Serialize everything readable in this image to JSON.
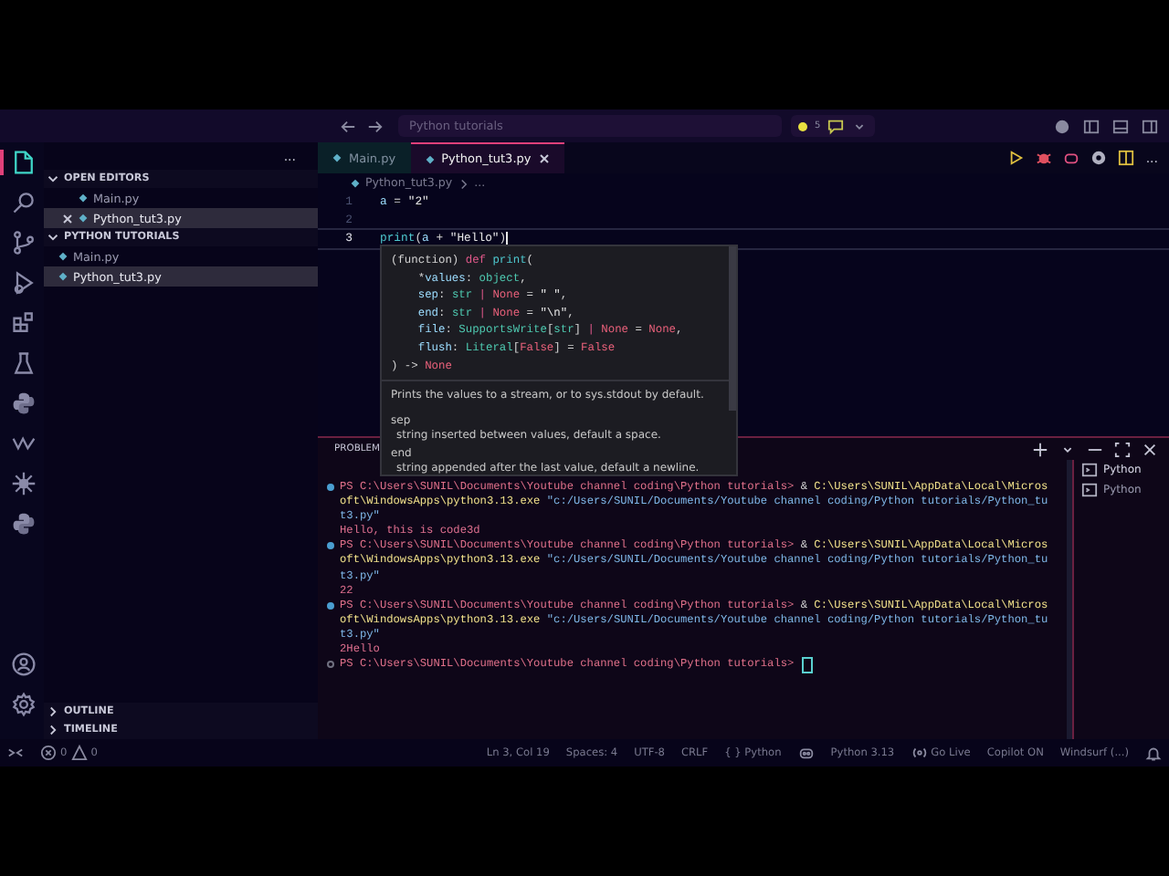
{
  "title_bar": {
    "search": "Python tutorials",
    "badge": "5"
  },
  "activity_bar": {
    "items": [
      {
        "kind": "explorer",
        "selected": true
      },
      {
        "kind": "search",
        "selected": false
      },
      {
        "kind": "source-control",
        "selected": false
      },
      {
        "kind": "debug",
        "selected": false
      },
      {
        "kind": "extensions",
        "selected": false
      },
      {
        "kind": "testing",
        "selected": false
      },
      {
        "kind": "python",
        "selected": false
      },
      {
        "kind": "zigzag",
        "selected": false
      },
      {
        "kind": "burst",
        "selected": false
      },
      {
        "kind": "python",
        "selected": false
      }
    ],
    "bottom": [
      {
        "kind": "account",
        "selected": false
      },
      {
        "kind": "settings",
        "selected": false
      }
    ]
  },
  "sidebar": {
    "more": "...",
    "sections": [
      {
        "title": "OPEN EDITORS",
        "expanded": true,
        "items": [
          {
            "label": "Main.py",
            "selected": false,
            "closable": false
          },
          {
            "label": "Python_tut3.py",
            "selected": true,
            "closable": true
          }
        ]
      },
      {
        "title": "PYTHON TUTORIALS",
        "expanded": true,
        "items": [
          {
            "label": "Main.py",
            "selected": false,
            "closable": false
          },
          {
            "label": "Python_tut3.py",
            "selected": true,
            "closable": false
          }
        ]
      }
    ],
    "bottom_sections": [
      {
        "title": "OUTLINE",
        "expanded": false
      },
      {
        "title": "TIMELINE",
        "expanded": false
      }
    ]
  },
  "tabs": [
    {
      "label": "Main.py",
      "selected": false
    },
    {
      "label": "Python_tut3.py",
      "selected": true
    }
  ],
  "editor_toolbar": {
    "more": "..."
  },
  "breadcrumb": [
    "Python_tut3.py",
    "..."
  ],
  "code": [
    {
      "number": "1",
      "current": false,
      "tokens": [
        {
          "kind": "var",
          "text": "a"
        },
        {
          "kind": "plain",
          "text": " = "
        },
        {
          "kind": "string",
          "text": "\"2\""
        }
      ]
    },
    {
      "number": "2",
      "current": false
    },
    {
      "number": "3",
      "current": true,
      "tokens": [
        {
          "kind": "fn",
          "text": "print"
        },
        {
          "kind": "plain",
          "text": "("
        },
        {
          "kind": "var",
          "text": "a"
        },
        {
          "kind": "plain",
          "text": " + "
        },
        {
          "kind": "string",
          "text": "\"Hello\""
        },
        {
          "kind": "plain",
          "text": ")"
        }
      ]
    }
  ],
  "hover": {
    "signature": [
      [
        {
          "kind": "plain",
          "text": "(function) "
        },
        {
          "kind": "keyword",
          "text": "def "
        },
        {
          "kind": "fn",
          "text": "print"
        },
        {
          "kind": "plain",
          "text": "("
        }
      ],
      [
        {
          "kind": "plain",
          "text": "    *"
        },
        {
          "kind": "param",
          "text": "values"
        },
        {
          "kind": "plain",
          "text": ": "
        },
        {
          "kind": "type",
          "text": "object"
        },
        {
          "kind": "plain",
          "text": ","
        }
      ],
      [
        {
          "kind": "param",
          "text": "    sep"
        },
        {
          "kind": "plain",
          "text": ": "
        },
        {
          "kind": "type",
          "text": "str"
        },
        {
          "kind": "keyword",
          "text": " | "
        },
        {
          "kind": "none",
          "text": "None"
        },
        {
          "kind": "plain",
          "text": " = "
        },
        {
          "kind": "string",
          "text": "\" \""
        },
        {
          "kind": "plain",
          "text": ","
        }
      ],
      [
        {
          "kind": "param",
          "text": "    end"
        },
        {
          "kind": "plain",
          "text": ": "
        },
        {
          "kind": "type",
          "text": "str"
        },
        {
          "kind": "keyword",
          "text": " | "
        },
        {
          "kind": "none",
          "text": "None"
        },
        {
          "kind": "plain",
          "text": " = "
        },
        {
          "kind": "string",
          "text": "\"\\n\""
        },
        {
          "kind": "plain",
          "text": ","
        }
      ],
      [
        {
          "kind": "param",
          "text": "    file"
        },
        {
          "kind": "plain",
          "text": ": "
        },
        {
          "kind": "type",
          "text": "SupportsWrite"
        },
        {
          "kind": "plain",
          "text": "["
        },
        {
          "kind": "type",
          "text": "str"
        },
        {
          "kind": "plain",
          "text": "]"
        },
        {
          "kind": "keyword",
          "text": " | "
        },
        {
          "kind": "none",
          "text": "None"
        },
        {
          "kind": "plain",
          "text": " = "
        },
        {
          "kind": "none",
          "text": "None"
        },
        {
          "kind": "plain",
          "text": ","
        }
      ],
      [
        {
          "kind": "param",
          "text": "    flush"
        },
        {
          "kind": "plain",
          "text": ": "
        },
        {
          "kind": "type",
          "text": "Literal"
        },
        {
          "kind": "plain",
          "text": "["
        },
        {
          "kind": "none",
          "text": "False"
        },
        {
          "kind": "plain",
          "text": "] = "
        },
        {
          "kind": "none",
          "text": "False"
        }
      ],
      [
        {
          "kind": "plain",
          "text": ") -> "
        },
        {
          "kind": "none",
          "text": "None"
        }
      ]
    ],
    "description": "Prints the values to a stream, or to sys.stdout by default.",
    "params": [
      {
        "name": "sep",
        "text": "string inserted between values, default a space."
      },
      {
        "name": "end",
        "text": "string appended after the last value, default a newline."
      }
    ]
  },
  "panel": {
    "tabs": [
      "PROBLEM"
    ],
    "terminal": [
      {
        "kind": "command",
        "lines": [
          [
            {
              "kind": "prompt",
              "text": "PS C:\\Users\\SUNIL\\Documents\\Youtube channel coding\\Python tutorials> "
            },
            {
              "kind": "plain",
              "text": "& "
            },
            {
              "kind": "exe",
              "text": "C:\\Users\\SUNIL\\AppData\\Local\\Micros"
            }
          ],
          [
            {
              "kind": "exe",
              "text": "oft\\WindowsApps\\python3.13.exe"
            },
            {
              "kind": "string",
              "text": " \"c:/Users/SUNIL/Documents/Youtube channel coding/Python tutorials/Python_tu"
            }
          ],
          [
            {
              "kind": "string",
              "text": "t3.py\""
            }
          ]
        ]
      },
      {
        "kind": "output",
        "lines": [
          [
            {
              "kind": "output",
              "text": "Hello, this is code3d"
            }
          ]
        ]
      },
      {
        "kind": "command",
        "lines": [
          [
            {
              "kind": "prompt",
              "text": "PS C:\\Users\\SUNIL\\Documents\\Youtube channel coding\\Python tutorials> "
            },
            {
              "kind": "plain",
              "text": "& "
            },
            {
              "kind": "exe",
              "text": "C:\\Users\\SUNIL\\AppData\\Local\\Micros"
            }
          ],
          [
            {
              "kind": "exe",
              "text": "oft\\WindowsApps\\python3.13.exe"
            },
            {
              "kind": "string",
              "text": " \"c:/Users/SUNIL/Documents/Youtube channel coding/Python tutorials/Python_tu"
            }
          ],
          [
            {
              "kind": "string",
              "text": "t3.py\""
            }
          ]
        ]
      },
      {
        "kind": "output",
        "lines": [
          [
            {
              "kind": "output",
              "text": "22"
            }
          ]
        ]
      },
      {
        "kind": "command",
        "lines": [
          [
            {
              "kind": "prompt",
              "text": "PS C:\\Users\\SUNIL\\Documents\\Youtube channel coding\\Python tutorials> "
            },
            {
              "kind": "plain",
              "text": "& "
            },
            {
              "kind": "exe",
              "text": "C:\\Users\\SUNIL\\AppData\\Local\\Micros"
            }
          ],
          [
            {
              "kind": "exe",
              "text": "oft\\WindowsApps\\python3.13.exe"
            },
            {
              "kind": "string",
              "text": " \"c:/Users/SUNIL/Documents/Youtube channel coding/Python tutorials/Python_tu"
            }
          ],
          [
            {
              "kind": "string",
              "text": "t3.py\""
            }
          ]
        ]
      },
      {
        "kind": "output",
        "lines": [
          [
            {
              "kind": "output",
              "text": "2Hello"
            }
          ]
        ]
      },
      {
        "kind": "prompt",
        "lines": [
          [
            {
              "kind": "prompt",
              "text": "PS C:\\Users\\SUNIL\\Documents\\Youtube channel coding\\Python tutorials> "
            }
          ]
        ]
      }
    ],
    "terminal_list": [
      {
        "label": "Python",
        "selected": true
      },
      {
        "label": "Python",
        "selected": false
      }
    ]
  },
  "status_bar": {
    "errors": "0",
    "warnings": "0",
    "items": [
      {
        "kind": "text",
        "label": "Ln 3, Col 19"
      },
      {
        "kind": "text",
        "label": "Spaces: 4"
      },
      {
        "kind": "text",
        "label": "UTF-8"
      },
      {
        "kind": "text",
        "label": "CRLF"
      },
      {
        "kind": "text",
        "label": "{ } Python"
      },
      {
        "kind": "copilot"
      },
      {
        "kind": "text",
        "label": "Python 3.13"
      },
      {
        "kind": "live",
        "label": "Go Live"
      },
      {
        "kind": "text",
        "label": "Copilot ON"
      },
      {
        "kind": "text",
        "label": "Windsurf (...)"
      },
      {
        "kind": "bell"
      }
    ]
  }
}
